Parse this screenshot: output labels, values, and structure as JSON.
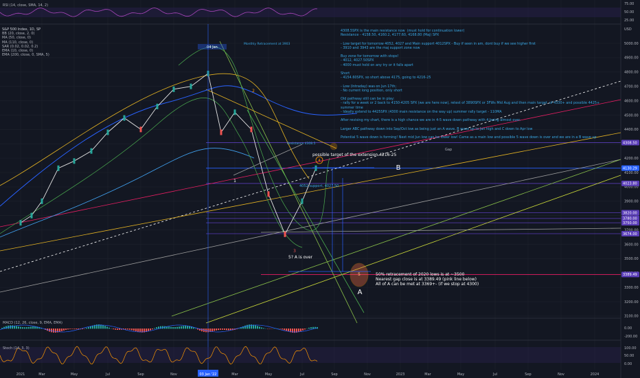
{
  "panels": {
    "rsi": {
      "label": "RSI (14, close, SMA, 14, 2)",
      "ticks": [
        "75.00",
        "50.00",
        "25.00"
      ]
    },
    "macd": {
      "label": "MACD (12, 26, close, 9, EMA, EMA)",
      "ticks": [
        "0.00",
        "-200.00"
      ]
    },
    "stoch": {
      "label": "Stoch (14, 3, 3)",
      "ticks": [
        "100.00",
        "50.00",
        "0.00"
      ]
    }
  },
  "legend": [
    "S&P 500 Index, 1D, SP",
    "BB (20, close, 2, 0)",
    "MA (50, close, 0)",
    "MA (110, close, 0)",
    "SAR (0.02, 0.02, 0.2)",
    "EMA (10, close, 0)",
    "EMA (200, close, 0, SMA, 5)"
  ],
  "notes": [
    "4308.5SPX is the main resistance now  (must hold for continuation lower)",
    "Resistance - 4158.50, 4160.2, 4177.60, 4168.80 (Maj) SPX",
    "",
    "- Low target for tomorrow 4052, 4027 and Main support 4012SPX - Buy if seen in am, dont buy if we see higher first",
    "- 3910 and 3943 are the maj support zone now",
    "",
    "Buy zone for tomorrow with stops!",
    "- 4012, 4027.50SPX",
    "- 4000 must hold on any try or it falls apart",
    "",
    "Short",
    "- 4154.60SPX, so short above 4175, going to 4216-25",
    "",
    "- Low (Intraday) was on Jun 17th;",
    "- No current long position, only short",
    "",
    "Old pathway still can be in play:",
    "- rally for a week or 2 back to 4150-4205 SPX (we are here now), retest of 3890SPX or 3FWs Mid Aug and then main target  of 4330+ and possible 4425+ summer time",
    "- Ideally extend to 4425SPX (4300 main resistance on the way up) summer rally target - 110MA",
    "",
    "After revising my chart, there is a high chance we are in 4-5 wave down pathway with 4 being almost over.",
    "",
    "Larger ABC pathway down into Sep/Oct low as being just an A wave, B wave up to Jan high and C down to Apr low",
    "",
    "Potential 5 wave down is forming! Next mid Jun low can be lower low! Came as a main low and possible 5 wave down is over and we are in a B wave up"
  ],
  "price_axis": [
    "USD",
    "5000.00",
    "4900.00",
    "4800.00",
    "4700.00",
    "4600.00",
    "4500.00",
    "4400.00",
    "4300.00",
    "4200.00",
    "4100.00",
    "4000.00",
    "3900.00",
    "3800.00",
    "3700.00",
    "3600.00",
    "3500.00",
    "3400.00",
    "3300.00",
    "3200.00",
    "3100.00"
  ],
  "price_tags": [
    {
      "text": "4308.50",
      "color": "#5a3db8"
    },
    {
      "text": "4130.29",
      "color": "#2962ff"
    },
    {
      "text": "4023.80",
      "color": "#5a3db8"
    },
    {
      "text": "3820.00",
      "color": "#5a3db8"
    },
    {
      "text": "3780.00",
      "color": "#5a3db8"
    },
    {
      "text": "3750.00",
      "color": "#5a3db8"
    },
    {
      "text": "3674.00",
      "color": "#5a3db8"
    },
    {
      "text": "3389.49",
      "color": "#5a3db8"
    }
  ],
  "time_axis": [
    "2021",
    "Mar",
    "May",
    "Jul",
    "Sep",
    "Nov",
    "03 Jan '22",
    "Mar",
    "May",
    "Jul",
    "Sep",
    "Nov",
    "2023",
    "Mar",
    "May",
    "Jul",
    "Sep",
    "Nov",
    "2024"
  ],
  "annotations": {
    "wave_1": "1",
    "wave_2": "2",
    "wave_3": "3",
    "wave_4": "4",
    "wave_5": "5",
    "label_b": "B",
    "label_a": "A",
    "target_text": "possible target of the extension 4216-25",
    "a_over": "5? A is over",
    "support_text": "4052 support, 4027.50",
    "retrace": [
      "50% retracement of 2020 lows is at ~3500",
      "Nearest gap close is at 3389.49 (pink line below)",
      "All of A can be met at 3369+- (if we stop at 4300)"
    ],
    "ath_label": "04 Jan",
    "small_label": "Monthly Retracement at 3903",
    "resistance_label": "Resistance 4308.5",
    "gap_label": "Gap"
  },
  "chart_data": {
    "type": "line",
    "title": "S&P 500 Index, 1D, SP",
    "xlabel": "",
    "ylabel": "USD",
    "ylim": [
      3050,
      5100
    ],
    "x": [
      "2021-01",
      "2021-02",
      "2021-03",
      "2021-04",
      "2021-05",
      "2021-06",
      "2021-07",
      "2021-08",
      "2021-09",
      "2021-10",
      "2021-11",
      "2021-12",
      "2022-01",
      "2022-02",
      "2022-03",
      "2022-04",
      "2022-05",
      "2022-06",
      "2022-07",
      "2022-08"
    ],
    "series": [
      {
        "values": [
          3750,
          3800,
          3900,
          4130,
          4180,
          4250,
          4380,
          4480,
          4400,
          4560,
          4680,
          4700,
          4790,
          4380,
          4520,
          4400,
          3950,
          3670,
          3900,
          4130
        ]
      }
    ],
    "levels": [
      4308.5,
      4130.29,
      4023.8,
      3820,
      3780,
      3750,
      3674,
      3389.49
    ],
    "grid": true,
    "legend": "top-left"
  }
}
